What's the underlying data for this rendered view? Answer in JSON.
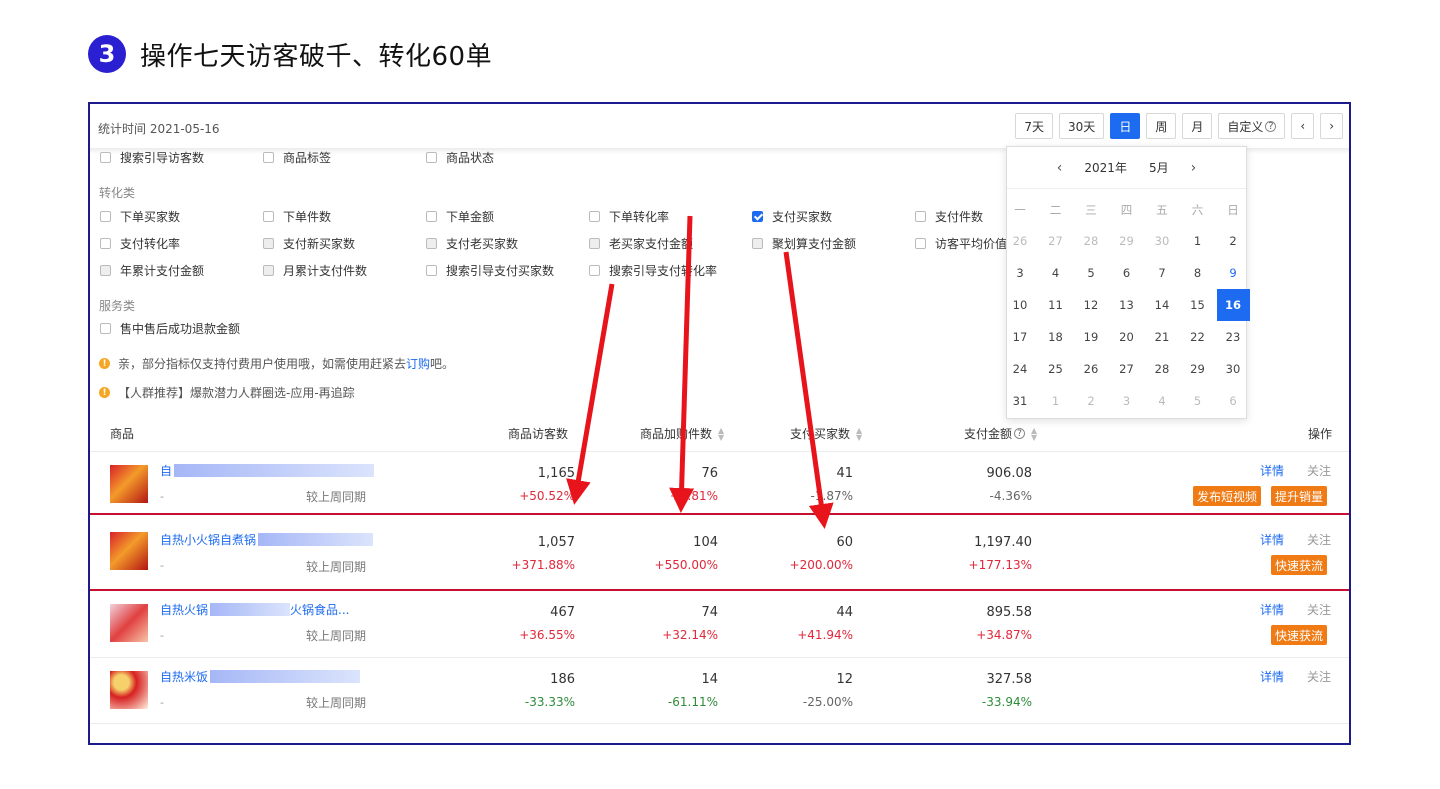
{
  "heading": {
    "badge": "3",
    "title": "操作七天访客破千、转化60单"
  },
  "toolbar": {
    "stat_time": "统计时间 2021-05-16",
    "periods": [
      "7天",
      "30天",
      "日",
      "周",
      "月",
      "自定义"
    ],
    "active_period": "日",
    "custom_info": "?",
    "prev": "‹",
    "next": "›"
  },
  "metrics": {
    "row0": [
      "搜索引导访客数",
      "商品标签",
      "商品状态"
    ],
    "conversion_label": "转化类",
    "row1": [
      "下单买家数",
      "下单件数",
      "下单金额",
      "下单转化率",
      "支付买家数",
      "支付件数"
    ],
    "row2": [
      "支付转化率",
      "支付新买家数",
      "支付老买家数",
      "老买家支付金额",
      "聚划算支付金额",
      "访客平均价值"
    ],
    "row3": [
      "年累计支付金额",
      "月累计支付件数",
      "搜索引导支付买家数",
      "搜索引导支付转化率"
    ],
    "service_label": "服务类",
    "row4": [
      "售中售后成功退款金额"
    ],
    "checked": "支付买家数"
  },
  "notices": {
    "n1_prefix": "亲，部分指标仅支持付费用户使用哦，如需使用赶紧去",
    "n1_link": "订购",
    "n1_suffix": "吧。",
    "n2": "【人群推荐】爆款潜力人群圈选-应用-再追踪"
  },
  "calendar": {
    "year": "2021年",
    "month": "5月",
    "weekdays": [
      "一",
      "二",
      "三",
      "四",
      "五",
      "六",
      "日"
    ],
    "days": [
      {
        "d": "26",
        "m": true
      },
      {
        "d": "27",
        "m": true
      },
      {
        "d": "28",
        "m": true
      },
      {
        "d": "29",
        "m": true
      },
      {
        "d": "30",
        "m": true
      },
      {
        "d": "1"
      },
      {
        "d": "2"
      },
      {
        "d": "3"
      },
      {
        "d": "4"
      },
      {
        "d": "5"
      },
      {
        "d": "6"
      },
      {
        "d": "7"
      },
      {
        "d": "8"
      },
      {
        "d": "9",
        "w": true
      },
      {
        "d": "10"
      },
      {
        "d": "11"
      },
      {
        "d": "12"
      },
      {
        "d": "13"
      },
      {
        "d": "14"
      },
      {
        "d": "15"
      },
      {
        "d": "16",
        "s": true
      },
      {
        "d": "17"
      },
      {
        "d": "18"
      },
      {
        "d": "19"
      },
      {
        "d": "20"
      },
      {
        "d": "21"
      },
      {
        "d": "22"
      },
      {
        "d": "23"
      },
      {
        "d": "24"
      },
      {
        "d": "25"
      },
      {
        "d": "26"
      },
      {
        "d": "27"
      },
      {
        "d": "28"
      },
      {
        "d": "29"
      },
      {
        "d": "30"
      },
      {
        "d": "31"
      },
      {
        "d": "1",
        "m": true
      },
      {
        "d": "2",
        "m": true
      },
      {
        "d": "3",
        "m": true
      },
      {
        "d": "4",
        "m": true
      },
      {
        "d": "5",
        "m": true
      },
      {
        "d": "6",
        "m": true
      }
    ]
  },
  "table": {
    "headers": {
      "product": "商品",
      "visitors": "商品访客数",
      "cart": "商品加购件数",
      "buyers": "支付买家数",
      "amount": "支付金额",
      "actions": "操作"
    },
    "rows": [
      {
        "name": "自",
        "sub": "-",
        "compare": "较上周同期",
        "visitors": "1,165",
        "visitors_pct": "+50.52%",
        "visitors_dir": "up",
        "cart": "76",
        "cart_pct": "+2.81%",
        "cart_dir": "up",
        "buyers": "41",
        "buyers_pct": "-1.87%",
        "buyers_dir": "neutral",
        "amount": "906.08",
        "amount_pct": "-4.36%",
        "amount_dir": "neutral",
        "detail": "详情",
        "follow": "关注",
        "buttons": [
          "发布短视频",
          "提升销量"
        ]
      },
      {
        "name": "自热小火锅自煮锅",
        "sub": "-",
        "compare": "较上周同期",
        "visitors": "1,057",
        "visitors_pct": "+371.88%",
        "visitors_dir": "up",
        "cart": "104",
        "cart_pct": "+550.00%",
        "cart_dir": "up",
        "buyers": "60",
        "buyers_pct": "+200.00%",
        "buyers_dir": "up",
        "amount": "1,197.40",
        "amount_pct": "+177.13%",
        "amount_dir": "up",
        "detail": "详情",
        "follow": "关注",
        "buttons": [
          "快速获流"
        ]
      },
      {
        "name": "自热火锅",
        "name_tail": "火锅食品...",
        "sub": "-",
        "compare": "较上周同期",
        "visitors": "467",
        "visitors_pct": "+36.55%",
        "visitors_dir": "up",
        "cart": "74",
        "cart_pct": "+32.14%",
        "cart_dir": "up",
        "buyers": "44",
        "buyers_pct": "+41.94%",
        "buyers_dir": "up",
        "amount": "895.58",
        "amount_pct": "+34.87%",
        "amount_dir": "up",
        "detail": "详情",
        "follow": "关注",
        "buttons": [
          "快速获流"
        ]
      },
      {
        "name": "自热米饭",
        "sub": "-",
        "compare": "较上周同期",
        "visitors": "186",
        "visitors_pct": "-33.33%",
        "visitors_dir": "down",
        "cart": "14",
        "cart_pct": "-61.11%",
        "cart_dir": "down",
        "buyers": "12",
        "buyers_pct": "-25.00%",
        "buyers_dir": "neutral",
        "amount": "327.58",
        "amount_pct": "-33.94%",
        "amount_dir": "down",
        "detail": "详情",
        "follow": "关注",
        "buttons": []
      }
    ]
  },
  "colors": {
    "accent_blue": "#1d6bf0",
    "badge_blue": "#2a1fd1",
    "frame": "#1d1b8c",
    "highlight_red": "#c8102e",
    "action_orange": "#f07a14",
    "up_red": "#e0283a",
    "down_green": "#2e8b3a",
    "arrow_red": "#e8141c"
  }
}
